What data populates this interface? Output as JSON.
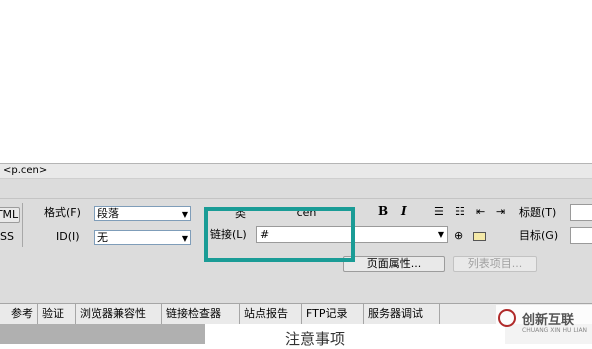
{
  "tagbar": {
    "path": "<p.cen>"
  },
  "left_buttons": {
    "html": "TML",
    "css": "SS"
  },
  "format": {
    "label": "格式(F)",
    "value": "段落"
  },
  "id": {
    "label": "ID(I)",
    "value": "无"
  },
  "class_field": {
    "label": "类",
    "value": "cen"
  },
  "link": {
    "label": "链接(L)",
    "value": "#"
  },
  "formatting": {
    "bold": "B",
    "italic": "I"
  },
  "title": {
    "label": "标题(T)"
  },
  "target": {
    "label": "目标(G)"
  },
  "buttons": {
    "page_props": "页面属性...",
    "list_item": "列表项目..."
  },
  "tabs": [
    "参考",
    "验证",
    "浏览器兼容性",
    "链接检查器",
    "站点报告",
    "FTP记录",
    "服务器调试"
  ],
  "document": {
    "partial_text": "注意事项"
  },
  "watermark": {
    "name": "创新互联",
    "sub": "CHUANG XIN HU LIAN"
  },
  "colors": {
    "highlight": "#1a9c96",
    "panel": "#dcdcdc"
  }
}
